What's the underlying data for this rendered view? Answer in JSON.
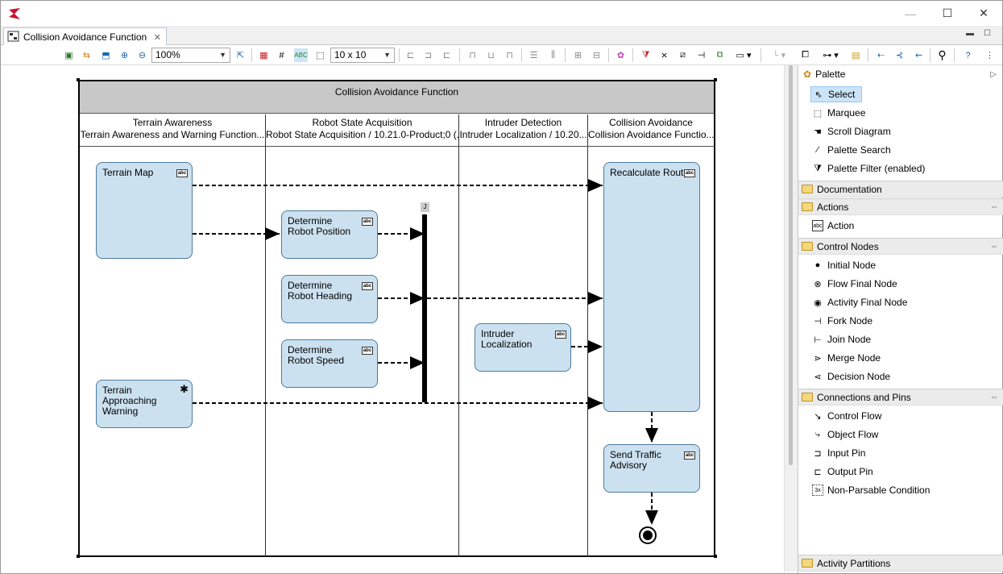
{
  "window": {
    "title_tab": "Collision Avoidance Function",
    "minimize_symbol": "—",
    "maximize_symbol": "☐",
    "close_symbol": "✕"
  },
  "toolbar": {
    "zoom_value": "100%",
    "grid_value": "10 x 10"
  },
  "diagram": {
    "frame_title": "Collision Avoidance Function",
    "lanes": [
      {
        "title": "Terrain Awareness",
        "subtitle": "Terrain Awareness and Warning Function..."
      },
      {
        "title": "Robot State Acquisition",
        "subtitle": "Robot State Acquisition / 10.21.0-Product;0 (..."
      },
      {
        "title": "Intruder Detection",
        "subtitle": "Intruder Localization / 10.20..."
      },
      {
        "title": "Collision Avoidance",
        "subtitle": "Collision Avoidance Functio..."
      }
    ],
    "actions": {
      "terrain_map": "Terrain Map",
      "terrain_warning": "Terrain Approaching Warning",
      "robot_position": "Determine Robot Position",
      "robot_heading": "Determine Robot Heading",
      "robot_speed": "Determine Robot Speed",
      "intruder_localization": "Intruder Localization",
      "recalculate_route": "Recalculate Route",
      "traffic_advisory": "Send Traffic Advisory"
    },
    "join_label": "J",
    "abc_badge": "abc"
  },
  "palette": {
    "header": "Palette",
    "tools": [
      {
        "label": "Select",
        "icon": "select-arrow-icon"
      },
      {
        "label": "Marquee",
        "icon": "marquee-icon"
      },
      {
        "label": "Scroll Diagram",
        "icon": "hand-icon"
      },
      {
        "label": "Palette Search",
        "icon": "search-wand-icon"
      },
      {
        "label": "Palette Filter (enabled)",
        "icon": "filter-icon"
      }
    ],
    "drawers": {
      "documentation": "Documentation",
      "actions": "Actions",
      "control_nodes": "Control Nodes",
      "connections": "Connections and Pins",
      "partitions": "Activity Partitions"
    },
    "action_items": [
      {
        "label": "Action",
        "icon": "action-icon"
      }
    ],
    "control_items": [
      {
        "label": "Initial Node",
        "icon": "initial-node-icon"
      },
      {
        "label": "Flow Final Node",
        "icon": "flow-final-icon"
      },
      {
        "label": "Activity Final Node",
        "icon": "activity-final-icon"
      },
      {
        "label": "Fork Node",
        "icon": "fork-icon"
      },
      {
        "label": "Join Node",
        "icon": "join-icon"
      },
      {
        "label": "Merge Node",
        "icon": "merge-icon"
      },
      {
        "label": "Decision Node",
        "icon": "decision-icon"
      }
    ],
    "connection_items": [
      {
        "label": "Control Flow",
        "icon": "control-flow-icon"
      },
      {
        "label": "Object Flow",
        "icon": "object-flow-icon"
      },
      {
        "label": "Input Pin",
        "icon": "input-pin-icon"
      },
      {
        "label": "Output Pin",
        "icon": "output-pin-icon"
      },
      {
        "label": "Non-Parsable Condition",
        "icon": "condition-icon"
      }
    ]
  }
}
